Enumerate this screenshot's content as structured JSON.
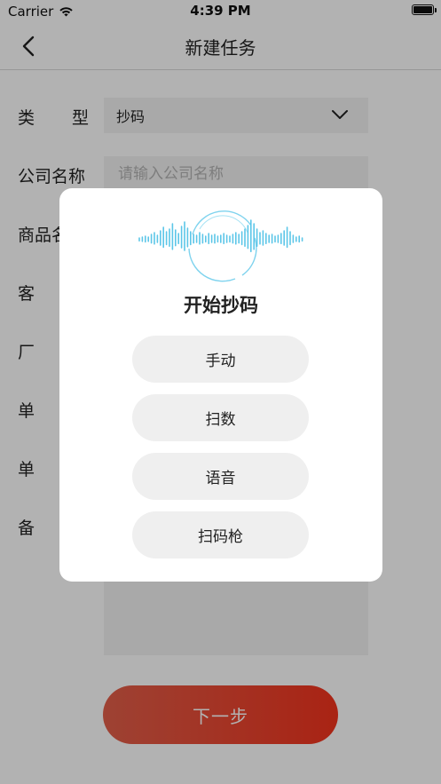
{
  "status_bar": {
    "carrier": "Carrier",
    "time": "4:39 PM"
  },
  "nav": {
    "title": "新建任务"
  },
  "form": {
    "type": {
      "label_chars": [
        "类",
        "型"
      ],
      "value": "抄码"
    },
    "company": {
      "label": "公司名称",
      "placeholder": "请输入公司名称"
    },
    "product": {
      "label": "商品名"
    },
    "customer": {
      "label": "客"
    },
    "factory": {
      "label": "厂"
    },
    "unit1": {
      "label": "单"
    },
    "unit2": {
      "label": "单"
    },
    "remark": {
      "label": "备"
    }
  },
  "next_button": {
    "label": "下一步"
  },
  "modal": {
    "title": "开始抄码",
    "options": [
      "手动",
      "扫数",
      "语音",
      "扫码枪"
    ]
  },
  "colors": {
    "accent": "#e8412c",
    "waveform": "#5cc6e8"
  }
}
